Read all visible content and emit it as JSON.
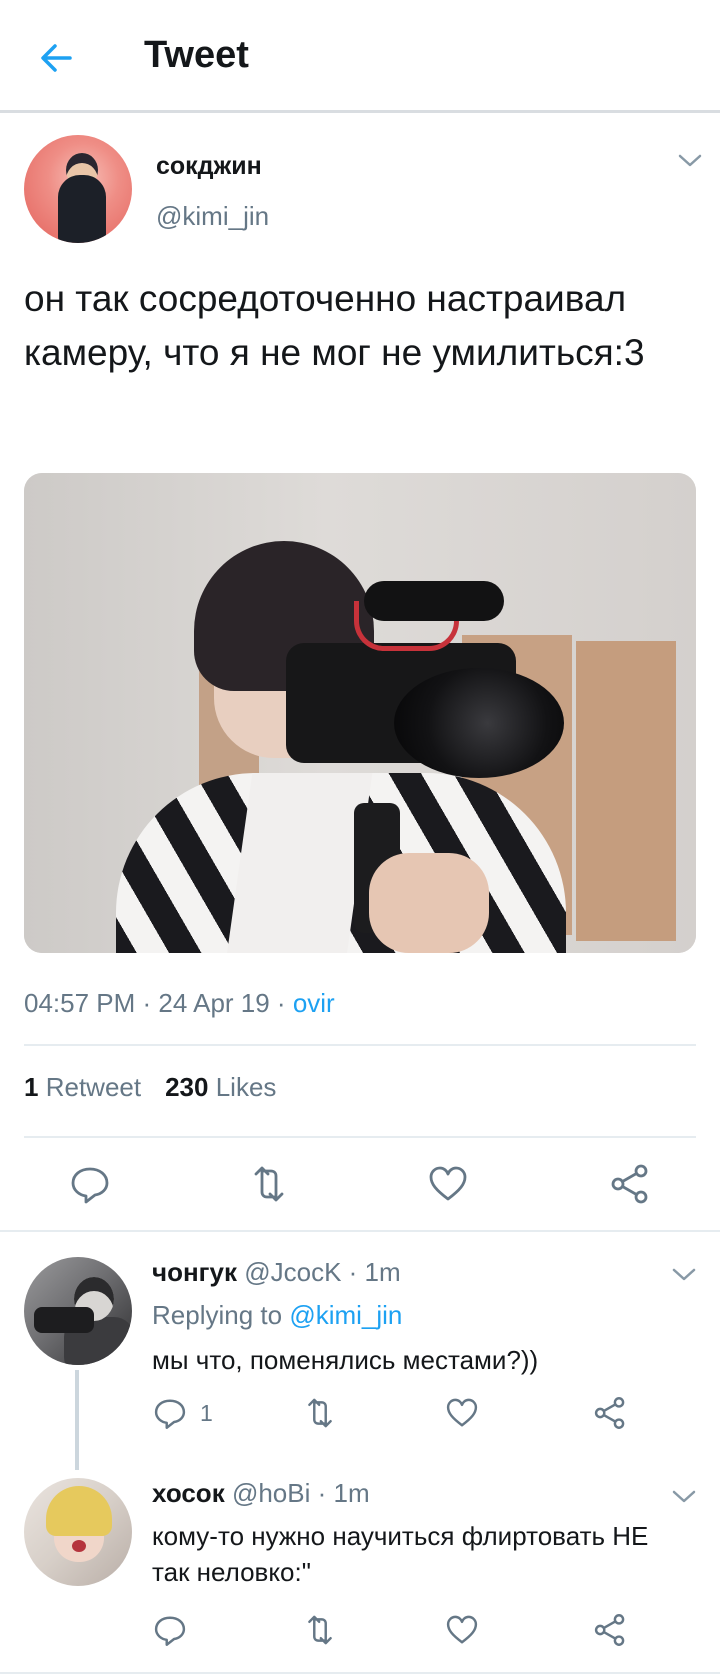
{
  "header": {
    "title": "Tweet"
  },
  "tweet": {
    "display_name": "сокджин",
    "handle": "@kimi_jin",
    "text": "он так сосредоточенно настраивал камеру, что я не мог не умилиться:3",
    "time": "04:57 PM · 24 Apr 19 · ",
    "source": "ovir",
    "retweet_count": "1",
    "retweet_label": "Retweet",
    "like_count": "230",
    "like_label": "Likes",
    "actions": [
      "reply-icon",
      "retweet-icon",
      "heart-icon",
      "share-icon"
    ]
  },
  "replies": [
    {
      "display_name": "чонгук",
      "handle": "@JcocK",
      "time": "· 1m",
      "replying_prefix": "Replying to ",
      "replying_to": "@kimi_jin",
      "text": "мы что, поменялись местами?))",
      "reply_count": "1"
    },
    {
      "display_name": "хосок",
      "handle": "@hoBi",
      "time": "· 1m",
      "text": "кому-то нужно научиться флиртовать НЕ так неловко:\""
    }
  ],
  "colors": {
    "accent": "#1da1f2",
    "muted": "#657786",
    "text": "#14171a",
    "divider": "#e6ecf0"
  }
}
